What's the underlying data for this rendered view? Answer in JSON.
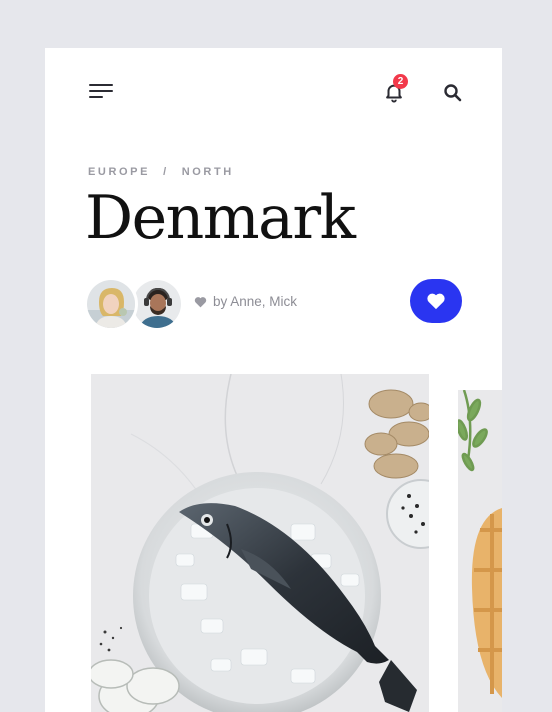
{
  "header": {
    "menu_icon": "hamburger-menu-icon",
    "notifications": {
      "icon": "bell-icon",
      "count": "2"
    },
    "search_icon": "search-icon"
  },
  "breadcrumb": {
    "region": "EUROPE",
    "separator": "/",
    "subregion": "NORTH"
  },
  "title": "Denmark",
  "authors": {
    "byline": "by Anne, Mick",
    "avatars": [
      "avatar-anne",
      "avatar-mick"
    ]
  },
  "like_button": {
    "icon": "heart-icon"
  },
  "colors": {
    "background": "#e6e7ec",
    "card": "#ffffff",
    "accent": "#2a35f1",
    "badge": "#f2394b",
    "muted_text": "#9a9aa2"
  },
  "gallery": {
    "images": [
      "photo-fish-on-ice-plate",
      "photo-pie-with-herbs"
    ]
  }
}
